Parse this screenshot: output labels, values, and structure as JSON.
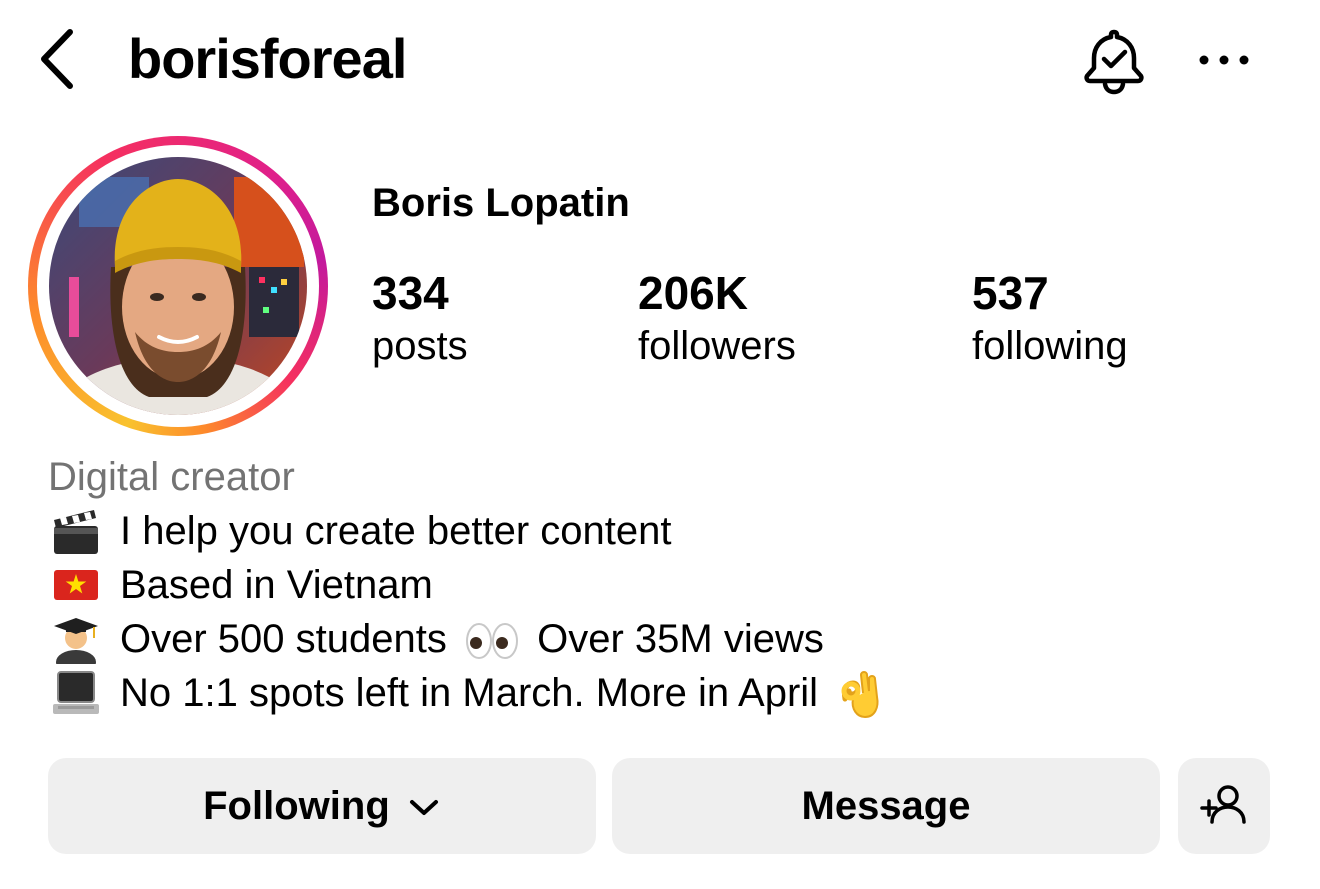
{
  "header": {
    "username": "borisforeal"
  },
  "profile": {
    "display_name": "Boris Lopatin",
    "category": "Digital creator",
    "stats": [
      {
        "value": "334",
        "label": "posts"
      },
      {
        "value": "206K",
        "label": "followers"
      },
      {
        "value": "537",
        "label": "following"
      }
    ],
    "bio": [
      {
        "icon": "clapperboard-emoji",
        "text": "I help you create better content"
      },
      {
        "icon": "vietnam-flag-emoji",
        "text": "Based in Vietnam"
      },
      {
        "icon": "student-emoji",
        "text": "Over 500 students",
        "inline_icon": "eyes-emoji",
        "text_after": "Over 35M views"
      },
      {
        "icon": "laptop-emoji",
        "text": "No 1:1 spots left in March. More in April",
        "trailing_icon": "ok-hand-emoji"
      }
    ]
  },
  "actions": {
    "following_label": "Following",
    "message_label": "Message"
  },
  "colors": {
    "button_bg": "#efefef",
    "category_text": "#737373",
    "story_ring": [
      "#f9c22e",
      "#fd8a2b",
      "#f5305f",
      "#c3199d"
    ]
  }
}
